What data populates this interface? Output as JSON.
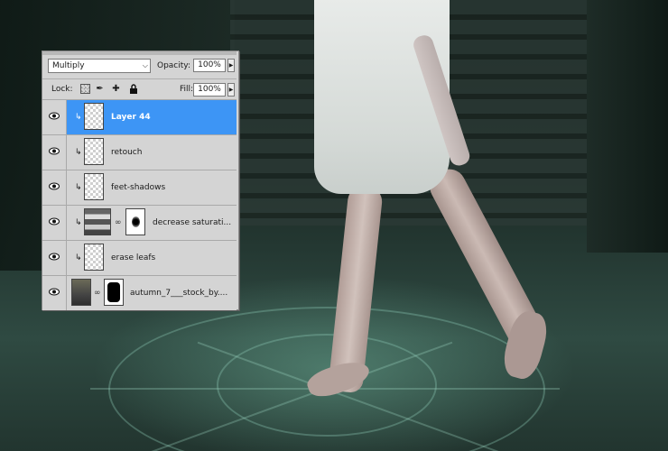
{
  "layers_panel": {
    "blend_mode": "Multiply",
    "opacity_label": "Opacity:",
    "opacity_value": "100%",
    "lock_label": "Lock:",
    "fill_label": "Fill:",
    "fill_value": "100%",
    "layers": [
      {
        "name": "Layer 44",
        "selected": true,
        "clipped": true,
        "thumb": "transparent"
      },
      {
        "name": "retouch",
        "selected": false,
        "clipped": true,
        "thumb": "transparent"
      },
      {
        "name": "feet-shadows",
        "selected": false,
        "clipped": true,
        "thumb": "transparent"
      },
      {
        "name": "decrease saturati...",
        "selected": false,
        "clipped": true,
        "thumb": "adjustment",
        "mask": "blob"
      },
      {
        "name": "erase leafs",
        "selected": false,
        "clipped": true,
        "thumb": "transparent"
      },
      {
        "name": "autumn_7___stock_by....",
        "selected": false,
        "clipped": false,
        "thumb": "photo",
        "mask": "figure"
      }
    ]
  },
  "colors": {
    "selected_row": "#3d95f5",
    "panel_bg": "#d4d4d4"
  },
  "icons": {
    "visibility": "eye-icon",
    "clipping": "clip-arrow-icon",
    "link": "chain-link-icon",
    "lock_transparent": "checkerboard-icon",
    "lock_image": "brush-icon",
    "lock_position": "move-icon",
    "lock_all": "padlock-icon"
  }
}
